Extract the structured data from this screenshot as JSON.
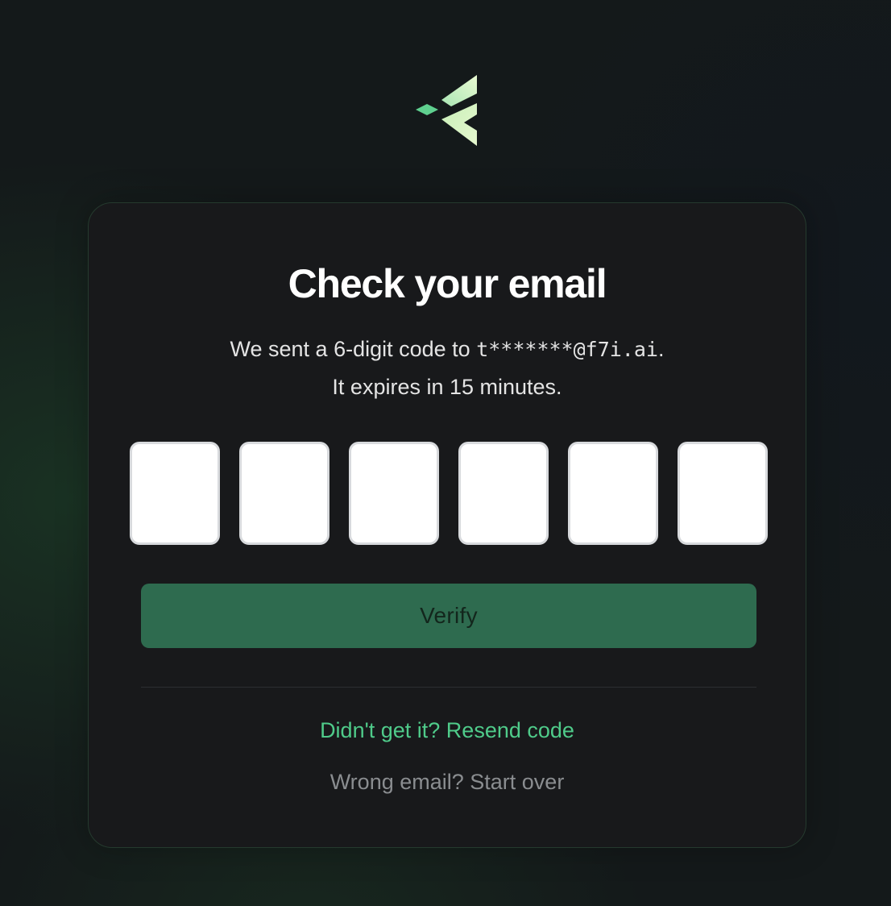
{
  "logo": {
    "icon": "brand-chevron-logo-icon",
    "colors": [
      "#6fd69a",
      "#c9f0b8",
      "#e8f9d0"
    ]
  },
  "card": {
    "title": "Check your email",
    "subtitle": {
      "prefix": "We sent a 6-digit code to ",
      "email": "t*******@f7i.ai",
      "suffix": ".",
      "line2": "It expires in 15 minutes."
    },
    "otp": {
      "length": 6,
      "values": [
        "",
        "",
        "",
        "",
        "",
        ""
      ]
    },
    "verify_label": "Verify",
    "resend_label": "Didn't get it? Resend code",
    "start_over_label": "Wrong email? Start over"
  },
  "colors": {
    "accent": "#4fcb8a",
    "button_bg": "#2e6b4f",
    "card_bg": "#18191b",
    "card_border": "#253a2e"
  }
}
